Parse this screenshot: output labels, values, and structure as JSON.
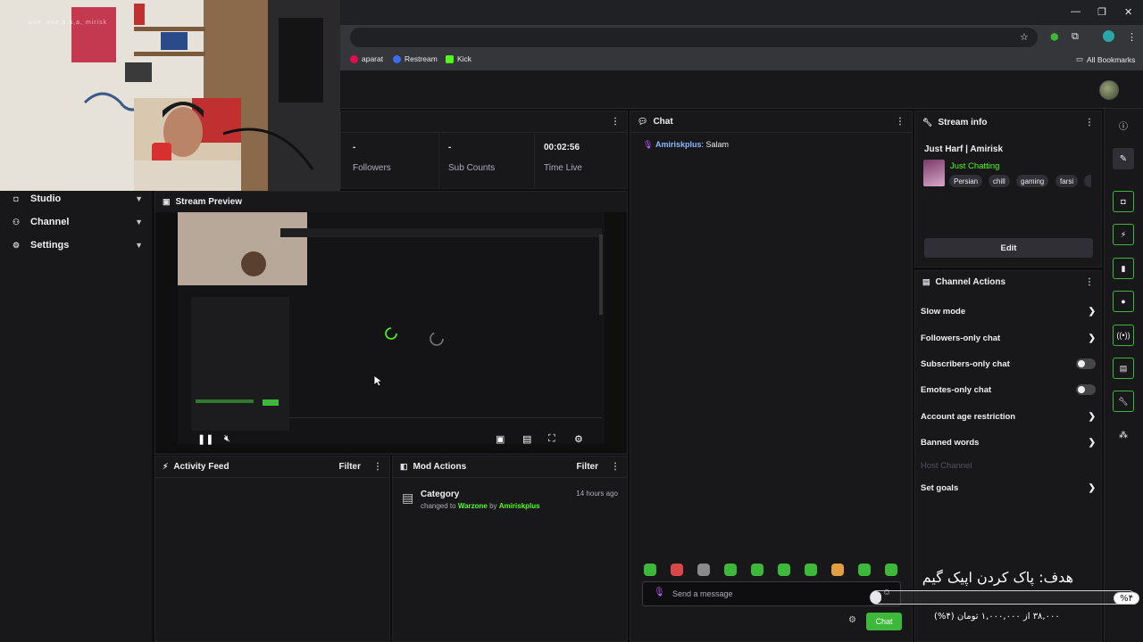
{
  "browser": {
    "bookmarks": [
      {
        "label": "aparat",
        "color": "#df0f50"
      },
      {
        "label": "Restream",
        "color": "#3a6df0"
      },
      {
        "label": "Kick",
        "color": "#53fc18"
      }
    ],
    "all_bookmarks": "All Bookmarks"
  },
  "webcam": {
    "watermark": "ase ,ase,a,a,a, mirisk"
  },
  "sidebar": {
    "items": [
      {
        "label": "Studio"
      },
      {
        "label": "Channel"
      },
      {
        "label": "Settings"
      }
    ]
  },
  "stats": [
    {
      "value": "-",
      "label": "Followers"
    },
    {
      "value": "-",
      "label": "Sub Counts"
    },
    {
      "value": "00:02:56",
      "label": "Time Live"
    }
  ],
  "preview": {
    "title": "Stream Preview"
  },
  "activity_feed": {
    "title": "Activity Feed",
    "filter": "Filter"
  },
  "mod_actions": {
    "title": "Mod Actions",
    "filter": "Filter",
    "entries": [
      {
        "title": "Category",
        "prefix": "changed to",
        "category": "Warzone",
        "by": "by",
        "user": "Amiriskplus",
        "time": "14 hours ago"
      }
    ]
  },
  "chat": {
    "title": "Chat",
    "messages": [
      {
        "user": "Amiriskplus",
        "text": ": Salam"
      }
    ],
    "placeholder": "Send a message",
    "send_label": "Chat",
    "emote_colors": [
      "#3db83a",
      "#d94848",
      "#8a8a8a",
      "#3db83a",
      "#3db83a",
      "#3db83a",
      "#3db83a",
      "#e0a040",
      "#3db83a",
      "#3db83a"
    ]
  },
  "stream_info": {
    "title": "Stream info",
    "stream_title": "Just Harf | Amirisk",
    "category": "Just Chatting",
    "tags": [
      "Persian",
      "chill",
      "gaming",
      "farsi"
    ],
    "edit_label": "Edit"
  },
  "channel_actions": {
    "title": "Channel Actions",
    "items": [
      {
        "label": "Slow mode",
        "type": "chevron"
      },
      {
        "label": "Followers-only chat",
        "type": "chevron"
      },
      {
        "label": "Subscribers-only chat",
        "type": "toggle"
      },
      {
        "label": "Emotes-only chat",
        "type": "toggle"
      },
      {
        "label": "Account age restriction",
        "type": "chevron"
      },
      {
        "label": "Banned words",
        "type": "chevron"
      },
      {
        "label": "Host Channel",
        "type": "disabled"
      },
      {
        "label": "Set goals",
        "type": "chevron"
      }
    ]
  },
  "goal": {
    "title": "هدف: پاک کردن اپیک گیم",
    "percent_label": "%۴",
    "amount": "۳۸,۰۰۰ از ۱,۰۰۰,۰۰۰ تومان (۴%)",
    "progress": 0.04
  },
  "colors": {
    "accent": "#53fc18",
    "button_green": "#3db83a",
    "link_blue": "#8cb8ff"
  }
}
